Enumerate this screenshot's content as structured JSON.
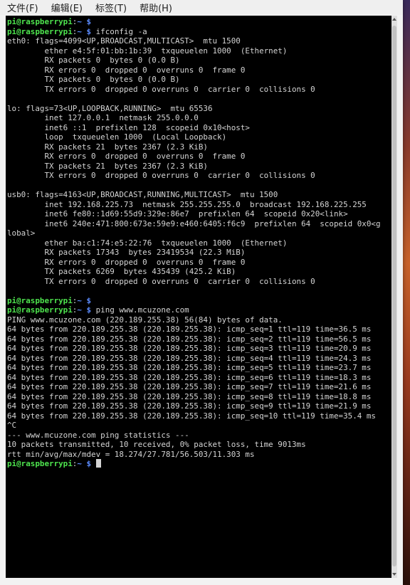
{
  "menu": {
    "items": [
      "文件(F)",
      "编辑(E)",
      "标签(T)",
      "帮助(H)"
    ]
  },
  "prompt": {
    "user_host": "pi@raspberrypi",
    "sep": ":",
    "path": "~ $"
  },
  "terminal": {
    "lines": [
      {
        "type": "prompt",
        "cmd": ""
      },
      {
        "type": "prompt",
        "cmd": " ifconfig -a"
      },
      {
        "type": "text",
        "text": "eth0: flags=4099<UP,BROADCAST,MULTICAST>  mtu 1500"
      },
      {
        "type": "text",
        "text": "        ether e4:5f:01:bb:1b:39  txqueuelen 1000  (Ethernet)"
      },
      {
        "type": "text",
        "text": "        RX packets 0  bytes 0 (0.0 B)"
      },
      {
        "type": "text",
        "text": "        RX errors 0  dropped 0  overruns 0  frame 0"
      },
      {
        "type": "text",
        "text": "        TX packets 0  bytes 0 (0.0 B)"
      },
      {
        "type": "text",
        "text": "        TX errors 0  dropped 0 overruns 0  carrier 0  collisions 0"
      },
      {
        "type": "text",
        "text": ""
      },
      {
        "type": "text",
        "text": "lo: flags=73<UP,LOOPBACK,RUNNING>  mtu 65536"
      },
      {
        "type": "text",
        "text": "        inet 127.0.0.1  netmask 255.0.0.0"
      },
      {
        "type": "text",
        "text": "        inet6 ::1  prefixlen 128  scopeid 0x10<host>"
      },
      {
        "type": "text",
        "text": "        loop  txqueuelen 1000  (Local Loopback)"
      },
      {
        "type": "text",
        "text": "        RX packets 21  bytes 2367 (2.3 KiB)"
      },
      {
        "type": "text",
        "text": "        RX errors 0  dropped 0  overruns 0  frame 0"
      },
      {
        "type": "text",
        "text": "        TX packets 21  bytes 2367 (2.3 KiB)"
      },
      {
        "type": "text",
        "text": "        TX errors 0  dropped 0 overruns 0  carrier 0  collisions 0"
      },
      {
        "type": "text",
        "text": ""
      },
      {
        "type": "text",
        "text": "usb0: flags=4163<UP,BROADCAST,RUNNING,MULTICAST>  mtu 1500"
      },
      {
        "type": "text",
        "text": "        inet 192.168.225.73  netmask 255.255.255.0  broadcast 192.168.225.255"
      },
      {
        "type": "text",
        "text": "        inet6 fe80::1d69:55d9:329e:86e7  prefixlen 64  scopeid 0x20<link>"
      },
      {
        "type": "text",
        "text": "        inet6 240e:471:800:673e:59e9:e460:6405:f6c9  prefixlen 64  scopeid 0x0<g"
      },
      {
        "type": "text",
        "text": "lobal>"
      },
      {
        "type": "text",
        "text": "        ether ba:c1:74:e5:22:76  txqueuelen 1000  (Ethernet)"
      },
      {
        "type": "text",
        "text": "        RX packets 17343  bytes 23419534 (22.3 MiB)"
      },
      {
        "type": "text",
        "text": "        RX errors 0  dropped 0  overruns 0  frame 0"
      },
      {
        "type": "text",
        "text": "        TX packets 6269  bytes 435439 (425.2 KiB)"
      },
      {
        "type": "text",
        "text": "        TX errors 0  dropped 0 overruns 0  carrier 0  collisions 0"
      },
      {
        "type": "text",
        "text": ""
      },
      {
        "type": "prompt",
        "cmd": ""
      },
      {
        "type": "prompt",
        "cmd": " ping www.mcuzone.com"
      },
      {
        "type": "text",
        "text": "PING www.mcuzone.com (220.189.255.38) 56(84) bytes of data."
      },
      {
        "type": "text",
        "text": "64 bytes from 220.189.255.38 (220.189.255.38): icmp_seq=1 ttl=119 time=36.5 ms"
      },
      {
        "type": "text",
        "text": "64 bytes from 220.189.255.38 (220.189.255.38): icmp_seq=2 ttl=119 time=56.5 ms"
      },
      {
        "type": "text",
        "text": "64 bytes from 220.189.255.38 (220.189.255.38): icmp_seq=3 ttl=119 time=20.9 ms"
      },
      {
        "type": "text",
        "text": "64 bytes from 220.189.255.38 (220.189.255.38): icmp_seq=4 ttl=119 time=24.3 ms"
      },
      {
        "type": "text",
        "text": "64 bytes from 220.189.255.38 (220.189.255.38): icmp_seq=5 ttl=119 time=23.7 ms"
      },
      {
        "type": "text",
        "text": "64 bytes from 220.189.255.38 (220.189.255.38): icmp_seq=6 ttl=119 time=18.3 ms"
      },
      {
        "type": "text",
        "text": "64 bytes from 220.189.255.38 (220.189.255.38): icmp_seq=7 ttl=119 time=21.6 ms"
      },
      {
        "type": "text",
        "text": "64 bytes from 220.189.255.38 (220.189.255.38): icmp_seq=8 ttl=119 time=18.8 ms"
      },
      {
        "type": "text",
        "text": "64 bytes from 220.189.255.38 (220.189.255.38): icmp_seq=9 ttl=119 time=21.9 ms"
      },
      {
        "type": "text",
        "text": "64 bytes from 220.189.255.38 (220.189.255.38): icmp_seq=10 ttl=119 time=35.4 ms"
      },
      {
        "type": "text",
        "text": "^C"
      },
      {
        "type": "text",
        "text": "--- www.mcuzone.com ping statistics ---"
      },
      {
        "type": "text",
        "text": "10 packets transmitted, 10 received, 0% packet loss, time 9013ms"
      },
      {
        "type": "text",
        "text": "rtt min/avg/max/mdev = 18.274/27.781/56.503/11.303 ms"
      },
      {
        "type": "prompt",
        "cmd": " ",
        "cursor": true
      }
    ]
  },
  "colors": {
    "prompt_user": "#4ee44e",
    "prompt_path": "#5c8cff",
    "terminal_bg": "#000000",
    "terminal_fg": "#d4d4d4"
  }
}
